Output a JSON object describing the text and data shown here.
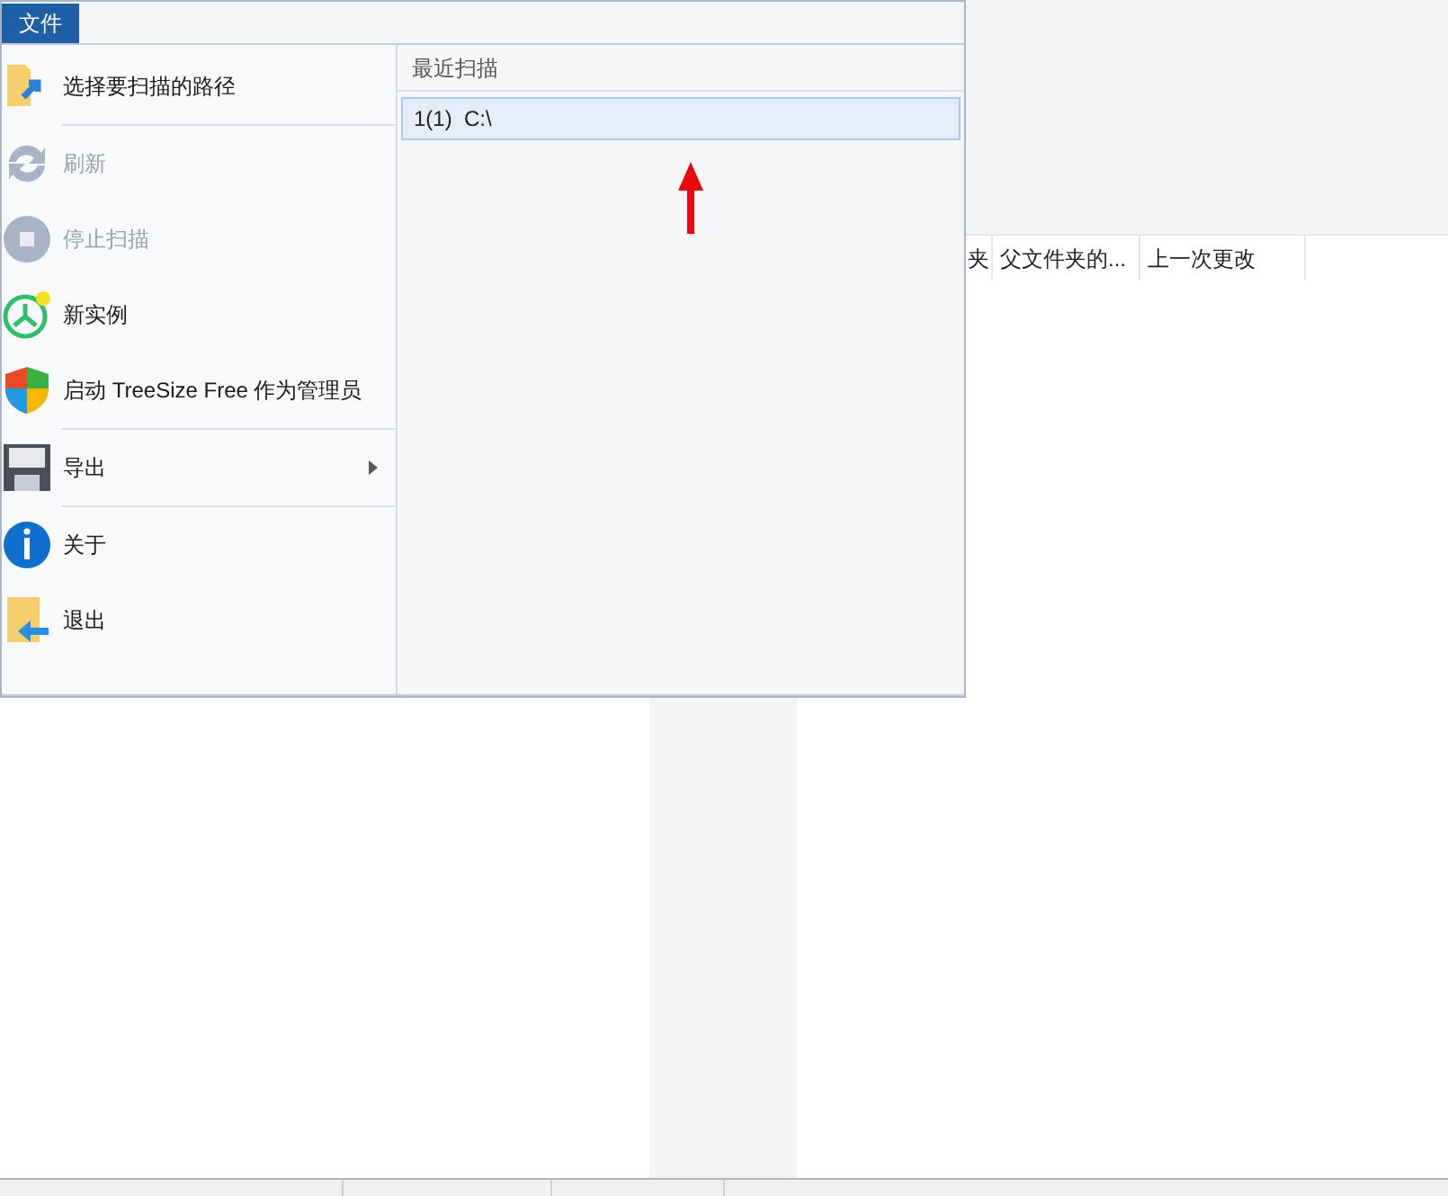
{
  "file_tab": {
    "label": "文件",
    "selected": true
  },
  "menu_sections": [
    [
      {
        "label": "选择要扫描的路径",
        "disabled": false,
        "submenu": false
      }
    ],
    [
      {
        "label": "刷新",
        "disabled": true,
        "submenu": false
      },
      {
        "label": "停止扫描",
        "disabled": true,
        "submenu": false
      },
      {
        "label": "新实例",
        "disabled": false,
        "submenu": false
      },
      {
        "label": "启动 TreeSize Free 作为管理员",
        "disabled": false,
        "submenu": false
      }
    ],
    [
      {
        "label": "导出",
        "disabled": false,
        "submenu": true
      }
    ],
    [
      {
        "label": "关于",
        "disabled": false,
        "submenu": false
      },
      {
        "label": "退出",
        "disabled": false,
        "submenu": false
      }
    ]
  ],
  "recent": {
    "title": "最近扫描",
    "items": [
      {
        "label": "1(1)  C:\\",
        "selected": true
      }
    ]
  },
  "table": {
    "columns": [
      "夹",
      "父文件夹的...",
      "上一次更改"
    ]
  }
}
